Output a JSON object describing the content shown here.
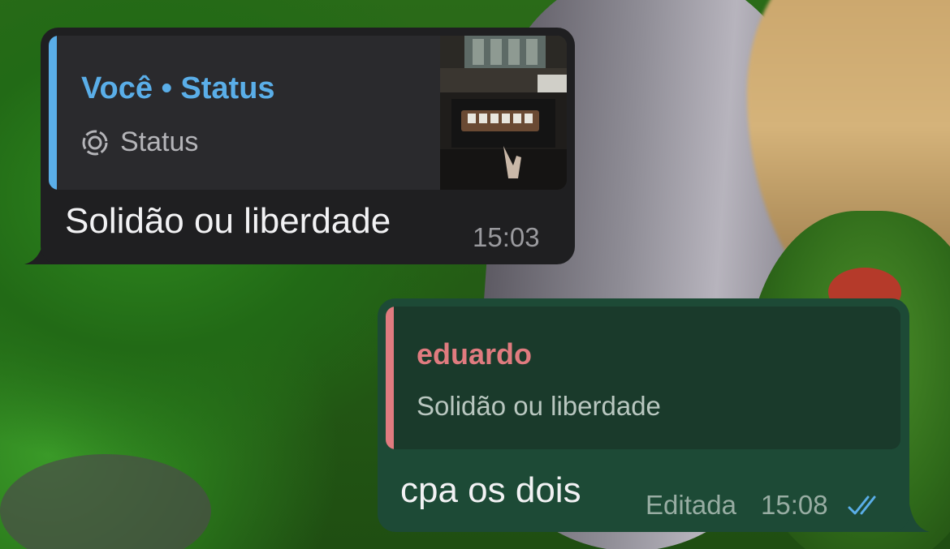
{
  "incoming_message": {
    "quote_title": "Você • Status",
    "quote_subtitle": "Status",
    "quote_icon": "status-ring-icon",
    "text": "Solidão ou liberdade",
    "time": "15:03"
  },
  "outgoing_message": {
    "quote_author": "eduardo",
    "quote_text": "Solidão ou liberdade",
    "text": "cpa os dois",
    "edited_label": "Editada",
    "time": "15:08",
    "status_icon": "double-check-icon"
  },
  "colors": {
    "incoming_bubble": "#1f1f21",
    "outgoing_bubble": "#1d4a36",
    "status_accent": "#5aaee8",
    "reply_accent": "#e07b7f"
  }
}
